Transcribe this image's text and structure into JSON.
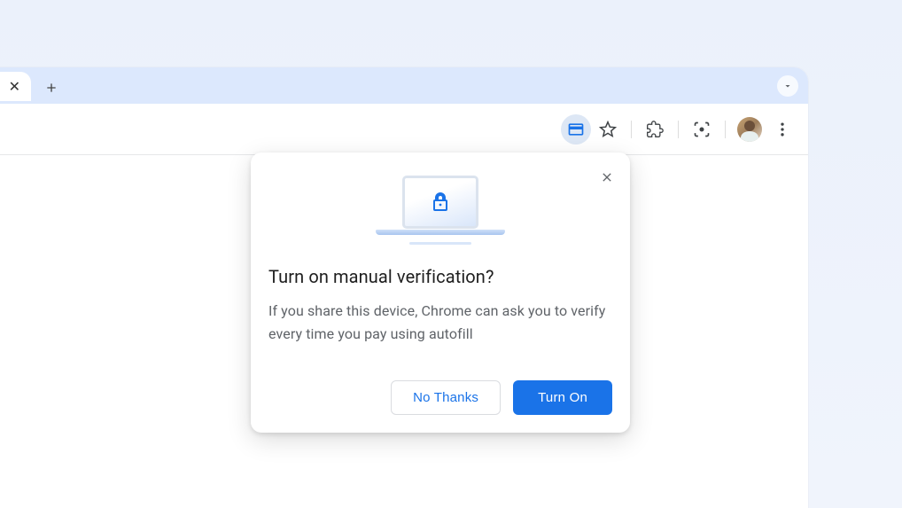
{
  "popup": {
    "title": "Turn on manual verification?",
    "body": "If you share this device, Chrome can ask you to verify every time you pay using autofill",
    "secondary": "No Thanks",
    "primary": "Turn On"
  }
}
